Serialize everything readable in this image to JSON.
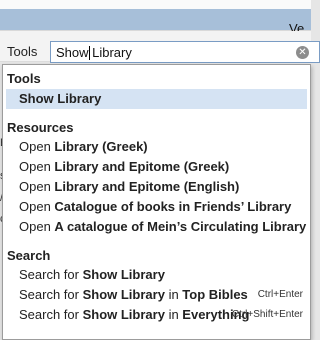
{
  "window": {
    "title": "Ve"
  },
  "toolbar": {
    "tools_label": "Tools",
    "search_value": "Show Library",
    "clear_icon": "clear-circle-icon"
  },
  "background_letters": [
    "E",
    "s",
    "/",
    "c"
  ],
  "dropdown": {
    "sections": [
      {
        "header": "Tools",
        "items": [
          {
            "pre": "",
            "bold": "Show Library",
            "post": "",
            "shortcut": "",
            "selected": true
          }
        ]
      },
      {
        "header": "Resources",
        "items": [
          {
            "pre": "Open ",
            "bold": "Library (Greek)",
            "post": "",
            "shortcut": "",
            "selected": false
          },
          {
            "pre": "Open ",
            "bold": "Library and Epitome (Greek)",
            "post": "",
            "shortcut": "",
            "selected": false
          },
          {
            "pre": "Open ",
            "bold": "Library and Epitome (English)",
            "post": "",
            "shortcut": "",
            "selected": false
          },
          {
            "pre": "Open ",
            "bold": "Catalogue of books in Friends’ Library",
            "post": "",
            "shortcut": "",
            "selected": false
          },
          {
            "pre": "Open ",
            "bold": "A catalogue of Mein’s Circulating Library",
            "post": "",
            "shortcut": "",
            "selected": false
          }
        ]
      },
      {
        "header": "Search",
        "items": [
          {
            "pre": "Search for ",
            "bold": "Show Library",
            "post": "",
            "shortcut": "",
            "selected": false
          },
          {
            "pre": "Search for ",
            "bold": "Show Library",
            "post": " in ",
            "bold2": "Top Bibles",
            "shortcut": "Ctrl+Enter",
            "selected": false
          },
          {
            "pre": "Search for ",
            "bold": "Show Library",
            "post": " in ",
            "bold2": "Everything",
            "shortcut": "Ctrl+Shift+Enter",
            "selected": false
          }
        ]
      }
    ]
  }
}
